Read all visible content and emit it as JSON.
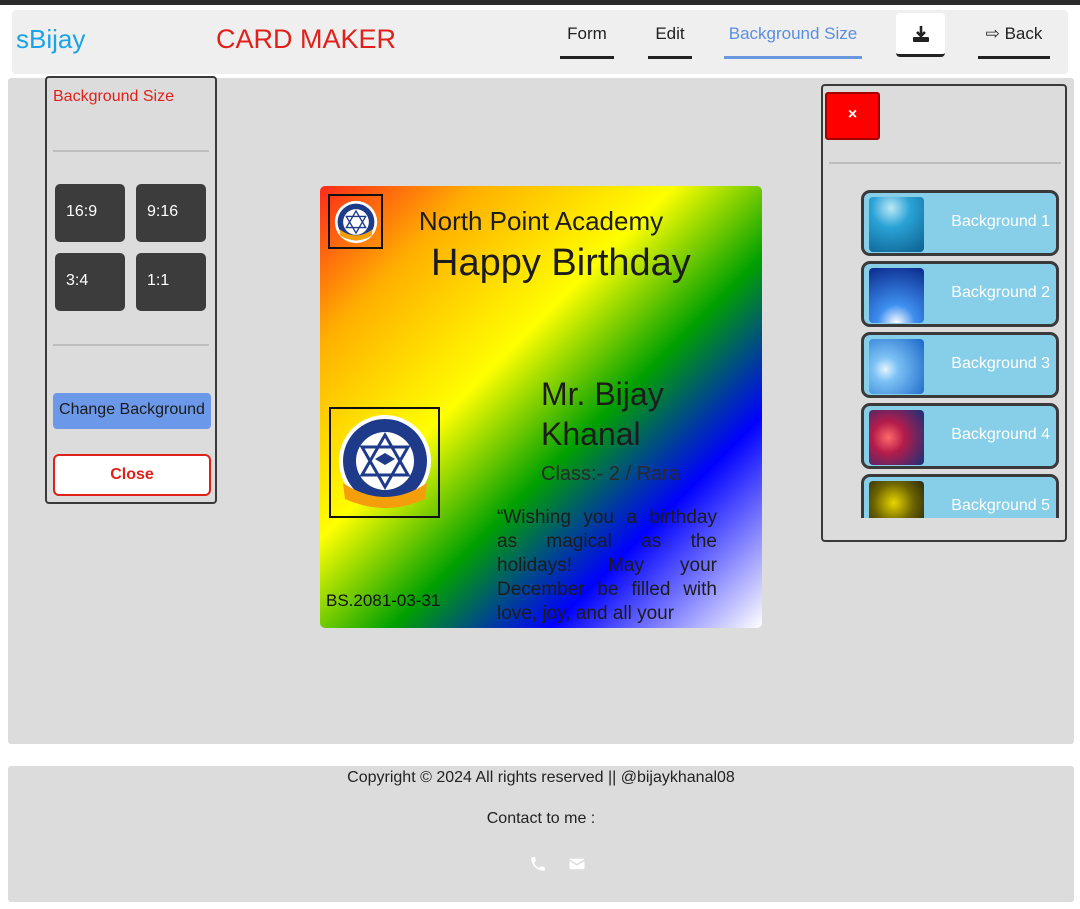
{
  "header": {
    "brand": "sBijay",
    "title": "CARD MAKER",
    "nav": {
      "form": "Form",
      "edit": "Edit",
      "background_size": "Background Size",
      "back": "⇨ Back"
    }
  },
  "left_panel": {
    "title": "Background Size",
    "ratios": [
      "16:9",
      "9:16",
      "3:4",
      "1:1"
    ],
    "change_background": "Change Background",
    "close": "Close"
  },
  "card": {
    "school": "North Point Academy",
    "greeting": "Happy Birthday",
    "name": "Mr. Bijay Khanal",
    "class": "Class:- 2 / Rara",
    "message": "“Wishing you a birthday as magical as the holidays! May your December be filled with love, joy, and all your",
    "date": "BS.2081-03-31"
  },
  "right_panel": {
    "close": "×",
    "backgrounds": [
      "Background 1",
      "Background 2",
      "Background 3",
      "Background 4",
      "Background 5"
    ]
  },
  "footer": {
    "copyright": "Copyright © 2024 All rights reserved || @bijaykhanal08",
    "contact": "Contact to me :"
  },
  "colors": {
    "brand": "#1aa3e8",
    "title": "#e0201a",
    "accent": "#6b98e8"
  },
  "icons": [
    "download-icon",
    "phone-icon",
    "mail-icon",
    "school-logo-icon"
  ]
}
